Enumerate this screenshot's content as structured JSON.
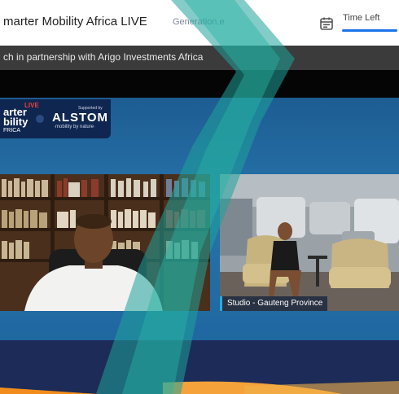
{
  "header": {
    "title": "marter Mobility Africa LIVE",
    "sponsor_link": "Generation.e",
    "time_left_label": "Time Left"
  },
  "banner": {
    "text": "ch in partnership with Arigo Investments Africa"
  },
  "logo": {
    "live": "LIVE",
    "line1": "arter",
    "line2": "bility",
    "line3": "FRICA",
    "supported_by": "Supported by",
    "brand": "ALSTOM",
    "tagline": "·mobility by nature·"
  },
  "videos": {
    "right_label": "Studio - Gauteng Province"
  },
  "colors": {
    "accent_blue": "#1a73e8",
    "teal_overlay": "#1fa39a",
    "stage_blue": "#2773aa",
    "orange": "#f28c1c",
    "label_bar": "#29a9e1"
  }
}
